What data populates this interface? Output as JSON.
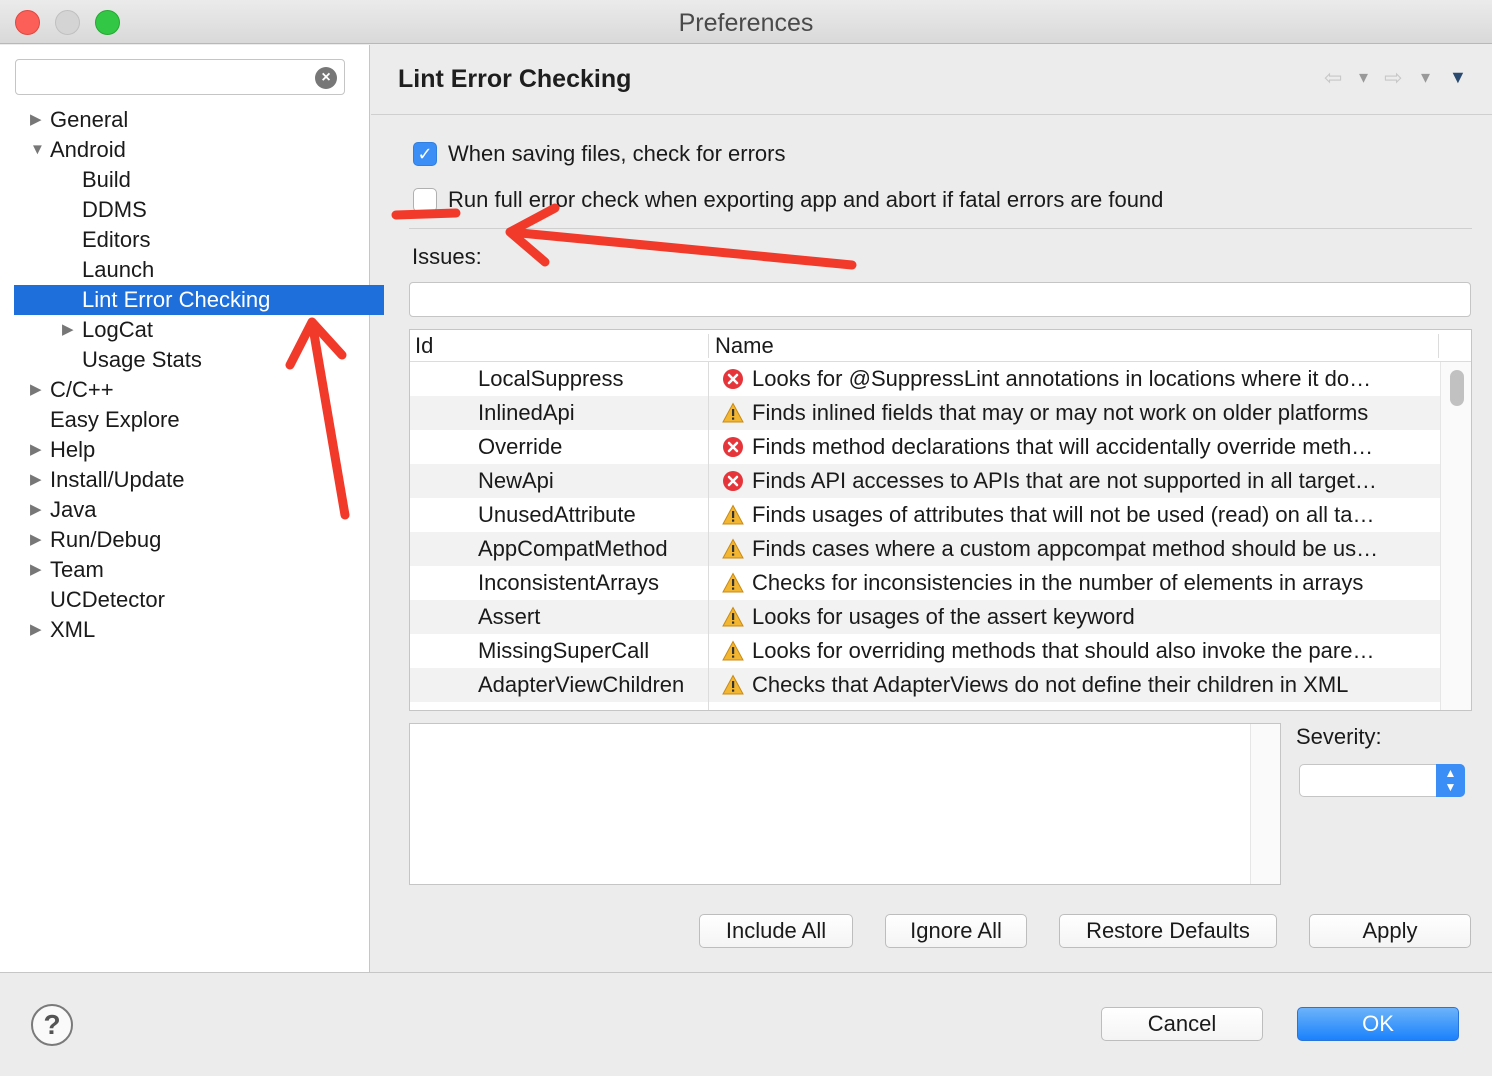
{
  "window": {
    "title": "Preferences"
  },
  "sidebar": {
    "filter_value": "",
    "items": [
      {
        "label": "General",
        "expandable": true,
        "expanded": false,
        "level": 0
      },
      {
        "label": "Android",
        "expandable": true,
        "expanded": true,
        "level": 0
      },
      {
        "label": "Build",
        "expandable": false,
        "level": 1
      },
      {
        "label": "DDMS",
        "expandable": false,
        "level": 1
      },
      {
        "label": "Editors",
        "expandable": false,
        "level": 1
      },
      {
        "label": "Launch",
        "expandable": false,
        "level": 1
      },
      {
        "label": "Lint Error Checking",
        "expandable": false,
        "level": 1,
        "selected": true
      },
      {
        "label": "LogCat",
        "expandable": true,
        "expanded": false,
        "level": 1
      },
      {
        "label": "Usage Stats",
        "expandable": false,
        "level": 1
      },
      {
        "label": "C/C++",
        "expandable": true,
        "expanded": false,
        "level": 0
      },
      {
        "label": "Easy Explore",
        "expandable": false,
        "level": 0
      },
      {
        "label": "Help",
        "expandable": true,
        "expanded": false,
        "level": 0
      },
      {
        "label": "Install/Update",
        "expandable": true,
        "expanded": false,
        "level": 0
      },
      {
        "label": "Java",
        "expandable": true,
        "expanded": false,
        "level": 0
      },
      {
        "label": "Run/Debug",
        "expandable": true,
        "expanded": false,
        "level": 0
      },
      {
        "label": "Team",
        "expandable": true,
        "expanded": false,
        "level": 0
      },
      {
        "label": "UCDetector",
        "expandable": false,
        "level": 0
      },
      {
        "label": "XML",
        "expandable": true,
        "expanded": false,
        "level": 0
      }
    ]
  },
  "page": {
    "title": "Lint Error Checking",
    "check_on_save": {
      "label": "When saving files, check for errors",
      "checked": true
    },
    "check_on_export": {
      "label": "Run full error check when exporting app and abort if fatal errors are found",
      "checked": false
    },
    "issues_label": "Issues:",
    "issues_filter_value": "",
    "table": {
      "columns": [
        "Id",
        "Name"
      ],
      "rows": [
        {
          "id": "LocalSuppress",
          "severity": "error",
          "name": "Looks for @SuppressLint annotations in locations where it do…"
        },
        {
          "id": "InlinedApi",
          "severity": "warning",
          "name": "Finds inlined fields that may or may not work on older platforms"
        },
        {
          "id": "Override",
          "severity": "error",
          "name": "Finds method declarations that will accidentally override meth…"
        },
        {
          "id": "NewApi",
          "severity": "error",
          "name": "Finds API accesses to APIs that are not supported in all target…"
        },
        {
          "id": "UnusedAttribute",
          "severity": "warning",
          "name": "Finds usages of attributes that will not be used (read) on all ta…"
        },
        {
          "id": "AppCompatMethod",
          "severity": "warning",
          "name": "Finds cases where a custom appcompat method should be us…"
        },
        {
          "id": "InconsistentArrays",
          "severity": "warning",
          "name": "Checks for inconsistencies in the number of elements in arrays"
        },
        {
          "id": "Assert",
          "severity": "warning",
          "name": "Looks for usages of the assert keyword"
        },
        {
          "id": "MissingSuperCall",
          "severity": "warning",
          "name": "Looks for overriding methods that should also invoke the pare…"
        },
        {
          "id": "AdapterViewChildren",
          "severity": "warning",
          "name": "Checks that AdapterViews do not define their children in XML"
        }
      ]
    },
    "severity_label": "Severity:",
    "severity_value": "",
    "buttons": {
      "include_all": "Include All",
      "ignore_all": "Ignore All",
      "restore_defaults": "Restore Defaults",
      "apply": "Apply"
    }
  },
  "footer": {
    "cancel": "Cancel",
    "ok": "OK"
  },
  "colors": {
    "selection": "#1e6fdb",
    "primary_button": "#1a82fb",
    "error": "#e5353a",
    "warning": "#f2b632",
    "annotation": "#f23a2a"
  }
}
